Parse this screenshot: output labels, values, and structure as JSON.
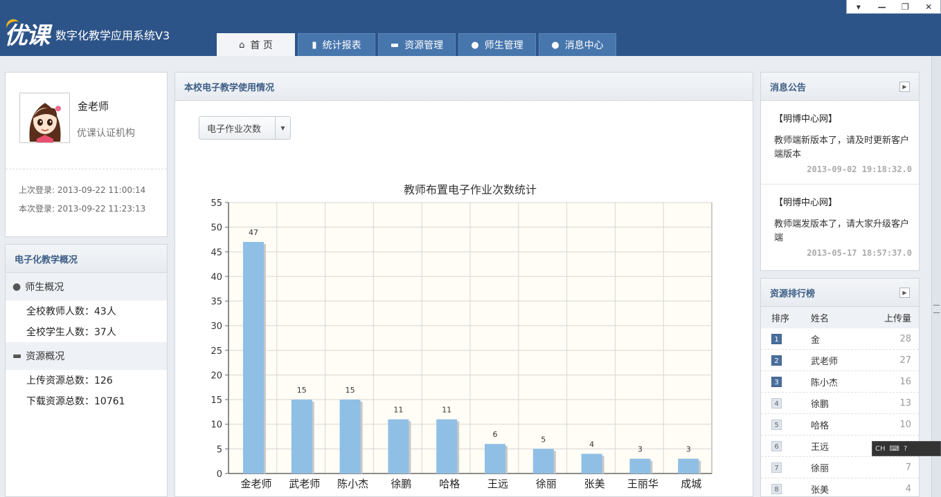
{
  "header": {
    "logo_text": "优课",
    "app_title": "数字化教学应用系统V3",
    "window_controls": [
      "▾",
      "—",
      "❐",
      "✕"
    ],
    "nav_tabs": [
      {
        "label": "首  页",
        "icon": "home-icon",
        "active": true
      },
      {
        "label": "统计报表",
        "icon": "bar-chart-icon",
        "active": false
      },
      {
        "label": "资源管理",
        "icon": "folder-icon",
        "active": false
      },
      {
        "label": "师生管理",
        "icon": "users-icon",
        "active": false
      },
      {
        "label": "消息中心",
        "icon": "chat-icon",
        "active": false
      }
    ]
  },
  "profile": {
    "name": "金老师",
    "org": "优课认证机构",
    "last_login": "上次登录: 2013-09-22 11:00:14",
    "this_login": "本次登录: 2013-09-22 11:23:13"
  },
  "overview": {
    "title": "电子化教学概况",
    "sections": [
      {
        "title": "师生概况",
        "icon": "users-icon",
        "lines": [
          "全校教师人数：43人",
          "全校学生人数：37人"
        ]
      },
      {
        "title": "资源概况",
        "icon": "folder-icon",
        "lines": [
          "上传资源总数：126",
          "下载资源总数：10761"
        ]
      }
    ]
  },
  "main": {
    "title": "本校电子教学使用情况",
    "select_value": "电子作业次数"
  },
  "chart_data": {
    "type": "bar",
    "title": "教师布置电子作业次数统计",
    "categories": [
      "金老师",
      "武老师",
      "陈小杰",
      "徐鹏",
      "哈格",
      "王远",
      "徐丽",
      "张美",
      "王丽华",
      "成城"
    ],
    "values": [
      47,
      15,
      15,
      11,
      11,
      6,
      5,
      4,
      3,
      3
    ],
    "ylim": [
      0,
      55
    ],
    "yticks": [
      0,
      5,
      10,
      15,
      20,
      25,
      30,
      35,
      40,
      45,
      50,
      55
    ],
    "grid": true,
    "bar_color": "#8fbfe5",
    "plot_bg": "#fffdf5"
  },
  "notice": {
    "title": "消息公告",
    "items": [
      {
        "source": "【明博中心网】",
        "body": "教师端新版本了，请及时更新客户端版本",
        "time": "2013-09-02 19:18:32.0"
      },
      {
        "source": "【明博中心网】",
        "body": "教师端发版本了，请大家升级客户端",
        "time": "2013-05-17 18:57:37.0"
      }
    ]
  },
  "rank": {
    "title": "资源排行榜",
    "headers": [
      "排序",
      "姓名",
      "上传量"
    ],
    "rows": [
      {
        "rank": "1",
        "name": "金",
        "count": "28"
      },
      {
        "rank": "2",
        "name": "武老师",
        "count": "27"
      },
      {
        "rank": "3",
        "name": "陈小杰",
        "count": "16"
      },
      {
        "rank": "4",
        "name": "徐鹏",
        "count": "13"
      },
      {
        "rank": "5",
        "name": "哈格",
        "count": "10"
      },
      {
        "rank": "6",
        "name": "王远",
        "count": ""
      },
      {
        "rank": "7",
        "name": "徐丽",
        "count": "7"
      },
      {
        "rank": "8",
        "name": "张美",
        "count": "4"
      }
    ]
  },
  "ime": {
    "label": "CH"
  }
}
